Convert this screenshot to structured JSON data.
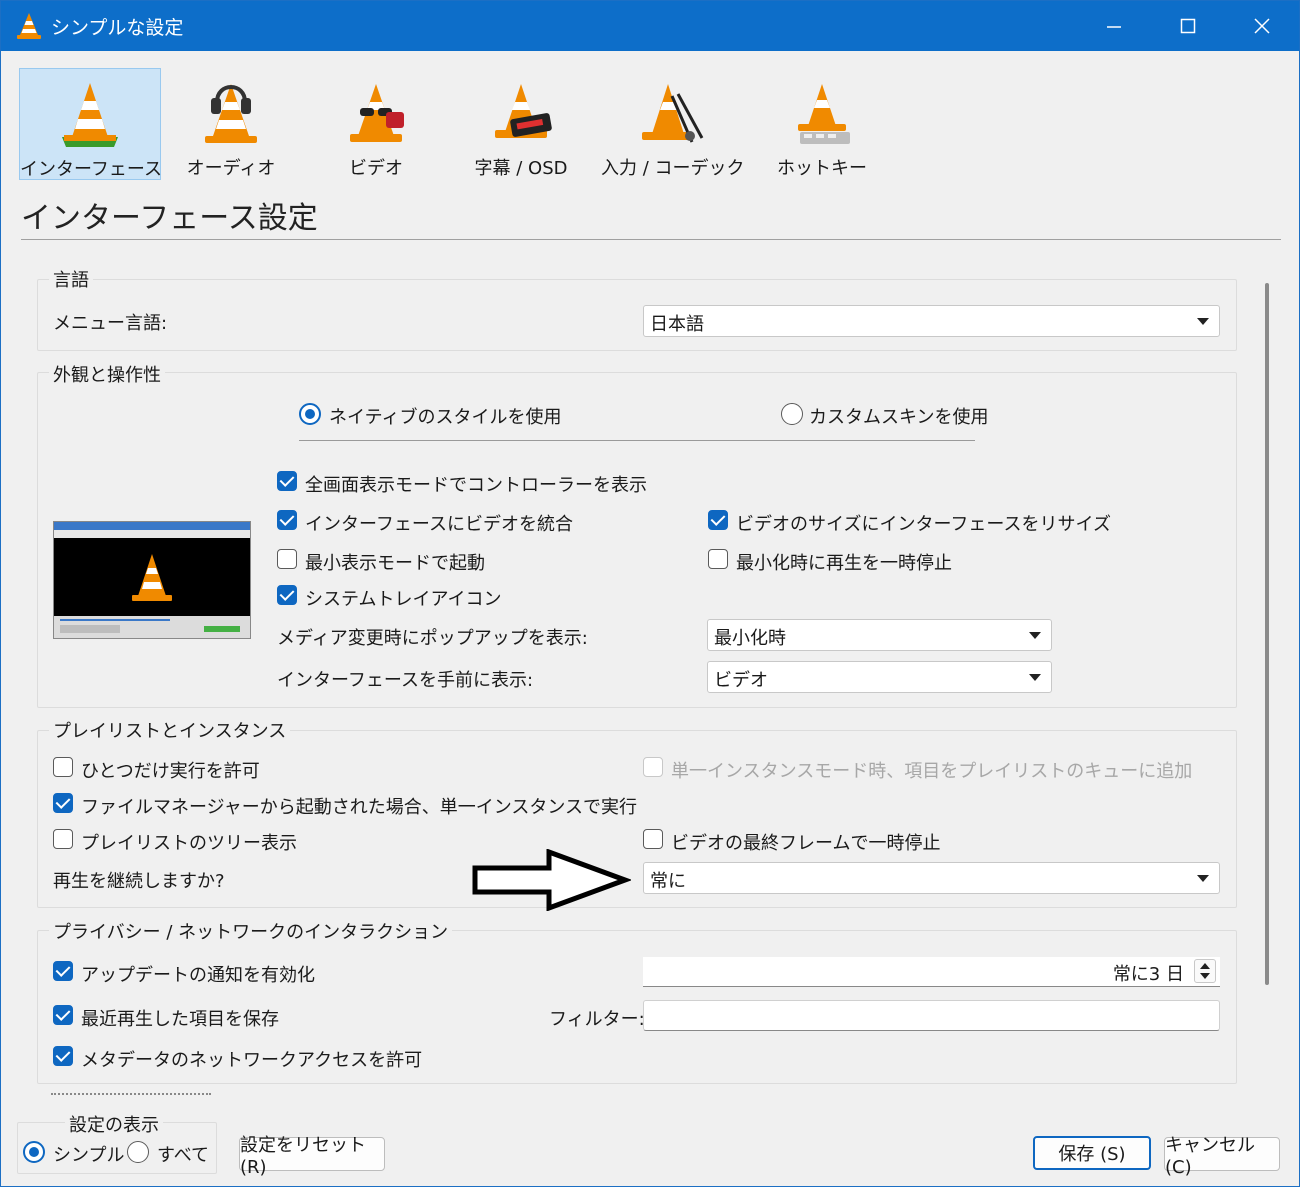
{
  "window": {
    "title": "シンプルな設定"
  },
  "toolbar": {
    "items": [
      {
        "label": "インターフェース",
        "icon": "interface-cone-icon"
      },
      {
        "label": "オーディオ",
        "icon": "audio-cone-icon"
      },
      {
        "label": "ビデオ",
        "icon": "video-cone-icon"
      },
      {
        "label": "字幕 / OSD",
        "icon": "subtitle-cone-icon"
      },
      {
        "label": "入力 / コーデック",
        "icon": "codec-cone-icon"
      },
      {
        "label": "ホットキー",
        "icon": "hotkey-cone-icon"
      }
    ]
  },
  "section_title": "インターフェース設定",
  "language": {
    "group": "言語",
    "menu_lang_label": "メニュー言語:",
    "menu_lang_value": "日本語"
  },
  "look": {
    "group": "外観と操作性",
    "native_style": "ネイティブのスタイルを使用",
    "custom_skin": "カスタムスキンを使用",
    "fs_controller": "全画面表示モードでコントローラーを表示",
    "embed_video": "インターフェースにビデオを統合",
    "resize_iface": "ビデオのサイズにインターフェースをリサイズ",
    "start_minimal": "最小表示モードで起動",
    "pause_minimized": "最小化時に再生を一時停止",
    "systray": "システムトレイアイコン",
    "popup_label": "メディア変更時にポップアップを表示:",
    "popup_value": "最小化時",
    "raise_label": "インターフェースを手前に表示:",
    "raise_value": "ビデオ"
  },
  "playlist": {
    "group": "プレイリストとインスタンス",
    "one_instance": "ひとつだけ実行を許可",
    "enqueue": "単一インスタンスモード時、項目をプレイリストのキューに追加",
    "fm_instance": "ファイルマネージャーから起動された場合、単一インスタンスで実行",
    "tree": "プレイリストのツリー表示",
    "pause_last": "ビデオの最終フレームで一時停止",
    "continue_label": "再生を継続しますか?",
    "continue_value": "常に"
  },
  "privacy": {
    "group": "プライバシー / ネットワークのインタラクション",
    "updates": "アップデートの通知を有効化",
    "update_value": "常に3 日",
    "recent": "最近再生した項目を保存",
    "filter_label": "フィルター:",
    "metadata": "メタデータのネットワークアクセスを許可"
  },
  "footer": {
    "group": "設定の表示",
    "simple": "シンプル",
    "all": "すべて",
    "reset": "設定をリセット (R)",
    "save": "保存 (S)",
    "cancel": "キャンセル (C)"
  },
  "colors": {
    "accent": "#0e67c1",
    "titlebar": "#0d6ec9",
    "cone_orange": "#f08a00"
  }
}
